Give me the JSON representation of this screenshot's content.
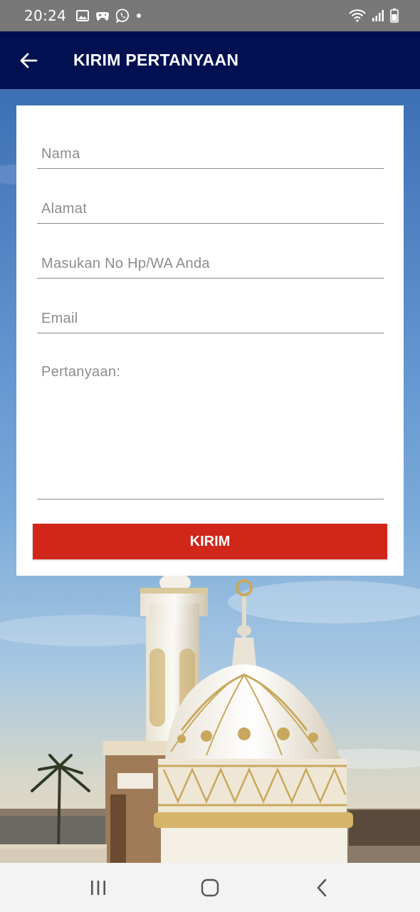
{
  "status_bar": {
    "time": "20:24",
    "left_icons": [
      "gallery-icon",
      "game-icon",
      "whatsapp-icon",
      "dot-icon"
    ],
    "right_icons": [
      "wifi-icon",
      "signal-icon",
      "battery-icon"
    ]
  },
  "app_bar": {
    "title": "KIRIM PERTANYAAN",
    "back_icon": "back-arrow-icon"
  },
  "form": {
    "name_placeholder": "Nama",
    "address_placeholder": "Alamat",
    "phone_placeholder": "Masukan No Hp/WA Anda",
    "email_placeholder": "Email",
    "question_placeholder": "Pertanyaan:",
    "submit_label": "KIRIM"
  },
  "nav_bar": {
    "icons": [
      "recent-apps-icon",
      "home-icon",
      "back-icon"
    ]
  },
  "colors": {
    "status_bar": "#787878",
    "app_bar": "#001051",
    "submit": "#d1271a",
    "card": "#ffffff",
    "nav_bar": "#f3f3f3"
  }
}
